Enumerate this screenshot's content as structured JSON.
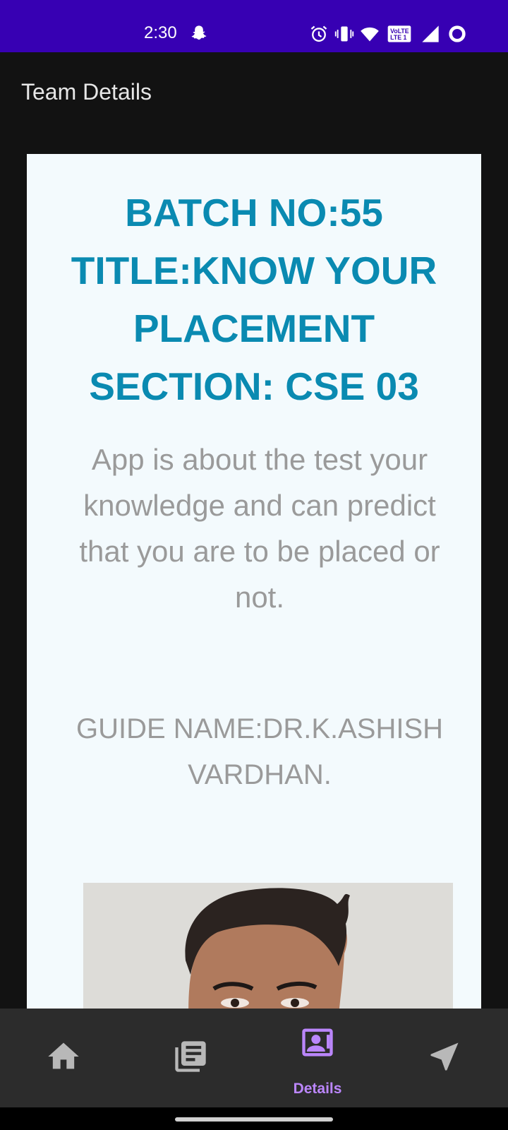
{
  "status_bar": {
    "time": "2:30",
    "icons": [
      "snapchat-icon",
      "alarm-icon",
      "vibrate-icon",
      "wifi-icon",
      "volte-icon",
      "signal-icon",
      "ring-icon"
    ]
  },
  "app_bar": {
    "title": "Team Details"
  },
  "card": {
    "header_lines": [
      "BATCH NO:55",
      "TITLE:KNOW YOUR",
      "PLACEMENT",
      "SECTION: CSE 03"
    ],
    "description": "App is about the test your knowledge and can predict that you are to be placed or not.",
    "guide": "GUIDE NAME:DR.K.ASHISH VARDHAN."
  },
  "bottom_nav": {
    "items": [
      {
        "icon": "home-icon",
        "label": ""
      },
      {
        "icon": "library-books-icon",
        "label": ""
      },
      {
        "icon": "contact-card-icon",
        "label": "Details"
      },
      {
        "icon": "navigation-arrow-icon",
        "label": ""
      }
    ],
    "selected_index": 2
  },
  "colors": {
    "status_bar": "#3700b3",
    "header_text": "#0a8ab1",
    "body_text": "#9a9a9a",
    "selected_nav": "#bb86fc",
    "unselected_nav": "#b8b8b8",
    "background": "#121212",
    "card_bg": "#f3fafd"
  }
}
